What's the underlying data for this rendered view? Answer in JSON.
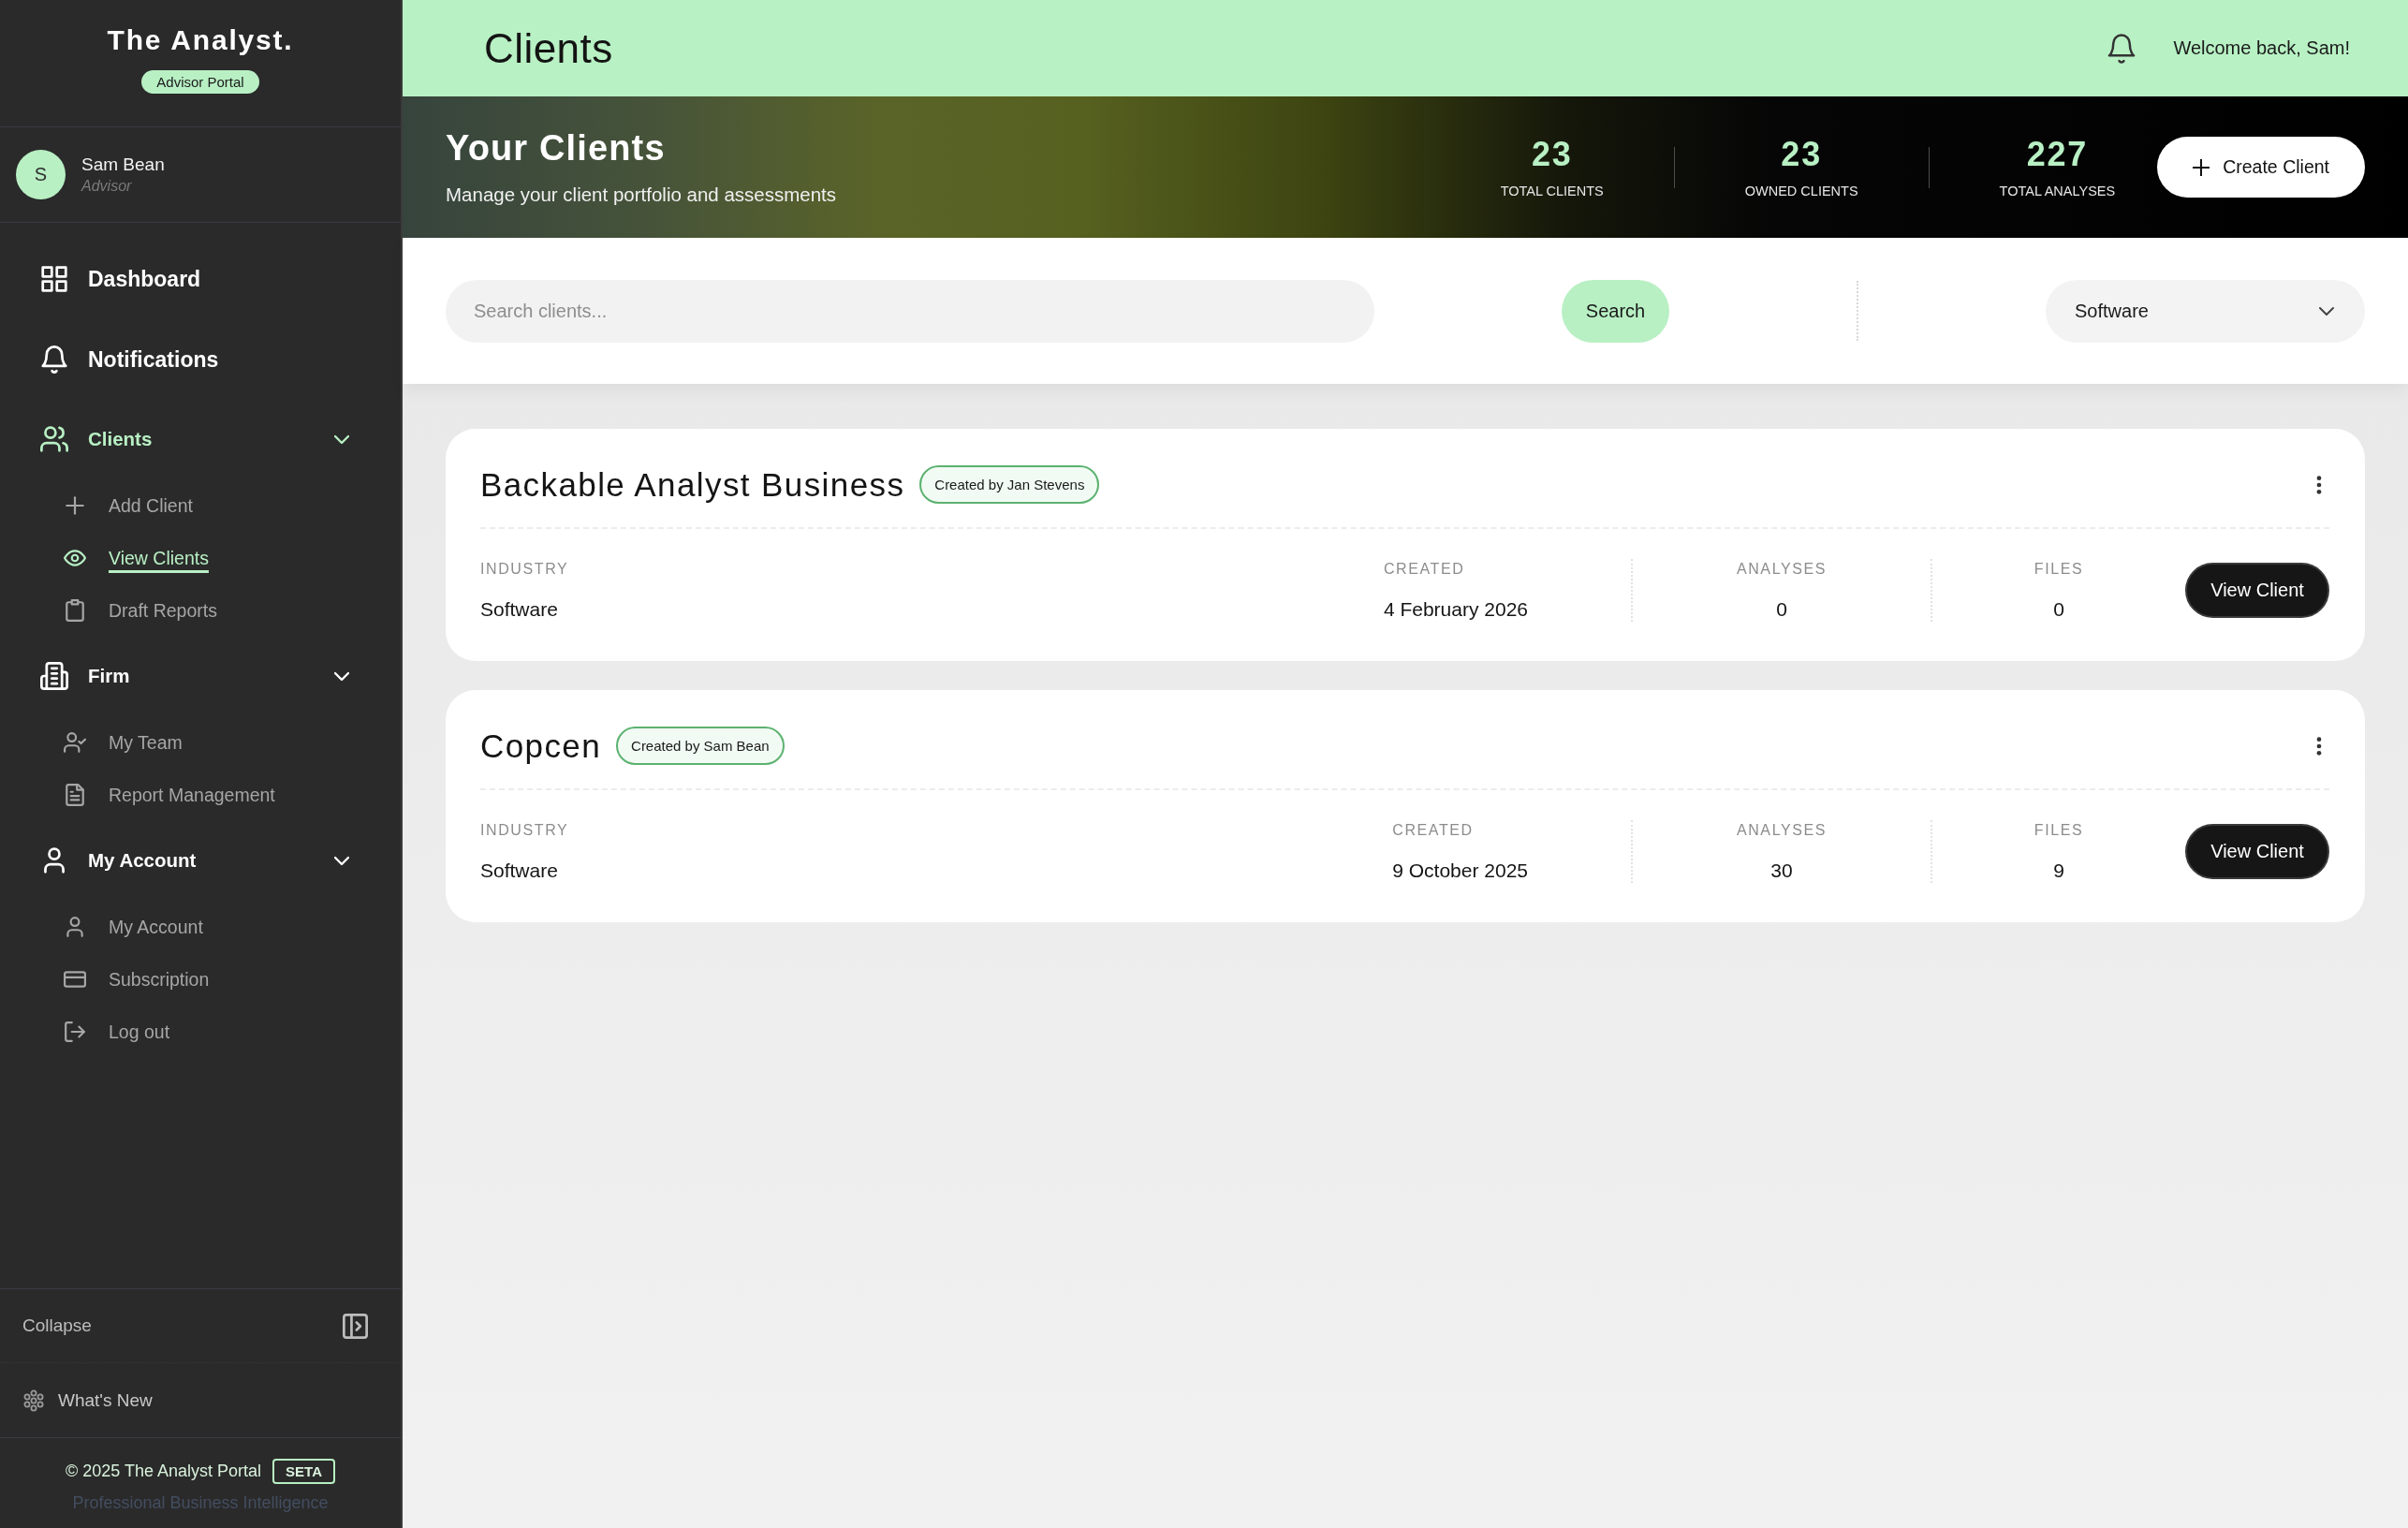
{
  "sidebar": {
    "logo": "The Analyst.",
    "portal_badge": "Advisor Portal",
    "user": {
      "initial": "S",
      "name": "Sam Bean",
      "role": "Advisor"
    },
    "nav": [
      {
        "label": "Dashboard",
        "selected": false
      },
      {
        "label": "Notifications",
        "selected": false
      },
      {
        "label": "Clients",
        "selected": false,
        "expanded": true,
        "children": [
          {
            "label": "Add Client",
            "selected": false
          },
          {
            "label": "View Clients",
            "selected": true
          },
          {
            "label": "Draft Reports",
            "selected": false
          }
        ]
      },
      {
        "label": "Firm",
        "selected": false,
        "expanded": true,
        "children": [
          {
            "label": "My Team",
            "selected": false
          },
          {
            "label": "Report Management",
            "selected": false
          }
        ]
      },
      {
        "label": "My Account",
        "selected": false,
        "expanded": true,
        "children": [
          {
            "label": "My Account",
            "selected": false
          },
          {
            "label": "Subscription",
            "selected": false
          },
          {
            "label": "Log out",
            "selected": false
          }
        ]
      }
    ],
    "collapse": "Collapse",
    "whats_new": "What's New",
    "footer": {
      "copyright": "© 2025 The Analyst Portal",
      "badge": "SETA",
      "tagline": "Professional Business Intelligence"
    }
  },
  "header": {
    "title": "Clients",
    "welcome": "Welcome back, Sam!"
  },
  "banner": {
    "title": "Your Clients",
    "subtitle": "Manage your client portfolio and assessments",
    "stats": [
      {
        "value": "23",
        "label": "TOTAL CLIENTS"
      },
      {
        "value": "23",
        "label": "OWNED CLIENTS"
      },
      {
        "value": "227",
        "label": "TOTAL ANALYSES"
      }
    ],
    "create_button": "Create Client"
  },
  "filters": {
    "search": {
      "placeholder": "Search clients..."
    },
    "search_button": "Search",
    "industry": {
      "value": "Software"
    }
  },
  "clients": [
    {
      "name": "Backable Analyst Business",
      "creator": "Created by Jan Stevens",
      "fields": [
        {
          "label": "INDUSTRY",
          "value": "Software"
        },
        {
          "label": "CREATED",
          "value": "4 February 2026"
        },
        {
          "label": "ANALYSES",
          "value": "0"
        },
        {
          "label": "FILES",
          "value": "0"
        }
      ],
      "button": "View Client"
    },
    {
      "name": "Copcen",
      "creator": "Created by Sam Bean",
      "fields": [
        {
          "label": "INDUSTRY",
          "value": "Software"
        },
        {
          "label": "CREATED",
          "value": "9 October 2025"
        },
        {
          "label": "ANALYSES",
          "value": "30"
        },
        {
          "label": "FILES",
          "value": "9"
        }
      ],
      "button": "View Client"
    }
  ]
}
